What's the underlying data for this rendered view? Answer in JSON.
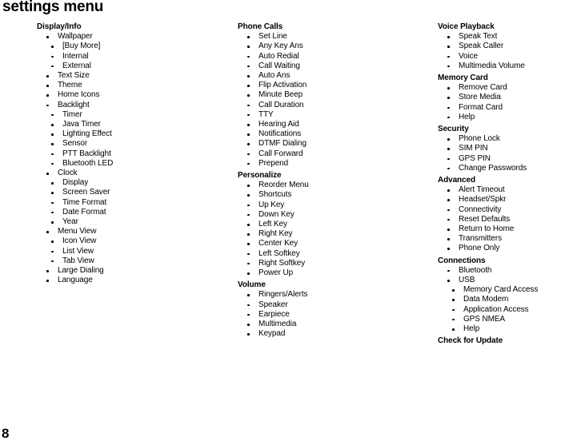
{
  "page": {
    "title": "settings menu",
    "number": "8"
  },
  "columns": [
    {
      "id": "col-1",
      "sections": [
        {
          "header": "Display/Info",
          "items": [
            {
              "label": "Wallpaper",
              "children": [
                {
                  "label": "[Buy More]"
                },
                {
                  "label": "Internal"
                },
                {
                  "label": "External"
                }
              ]
            },
            {
              "label": "Text Size"
            },
            {
              "label": "Theme"
            },
            {
              "label": "Home Icons"
            },
            {
              "label": "Backlight",
              "children": [
                {
                  "label": "Timer"
                },
                {
                  "label": "Java Timer"
                },
                {
                  "label": "Lighting Effect"
                },
                {
                  "label": "Sensor"
                },
                {
                  "label": "PTT Backlight"
                },
                {
                  "label": "Bluetooth LED"
                }
              ]
            },
            {
              "label": "Clock",
              "children": [
                {
                  "label": "Display"
                },
                {
                  "label": "Screen Saver"
                },
                {
                  "label": "Time Format"
                },
                {
                  "label": "Date Format"
                },
                {
                  "label": "Year"
                }
              ]
            },
            {
              "label": "Menu View",
              "children": [
                {
                  "label": "Icon View"
                },
                {
                  "label": "List View"
                },
                {
                  "label": "Tab View"
                }
              ]
            },
            {
              "label": "Large Dialing"
            },
            {
              "label": "Language"
            }
          ]
        }
      ]
    },
    {
      "id": "col-2",
      "sections": [
        {
          "header": "Phone Calls",
          "items": [
            {
              "label": "Set Line"
            },
            {
              "label": "Any Key Ans"
            },
            {
              "label": "Auto Redial"
            },
            {
              "label": "Call Waiting"
            },
            {
              "label": "Auto Ans"
            },
            {
              "label": "Flip Activation"
            },
            {
              "label": "Minute Beep"
            },
            {
              "label": "Call Duration"
            },
            {
              "label": "TTY"
            },
            {
              "label": "Hearing Aid"
            },
            {
              "label": "Notifications"
            },
            {
              "label": "DTMF Dialing"
            },
            {
              "label": "Call Forward"
            },
            {
              "label": "Prepend"
            }
          ]
        },
        {
          "header": "Personalize",
          "items": [
            {
              "label": "Reorder Menu"
            },
            {
              "label": "Shortcuts"
            },
            {
              "label": "Up Key"
            },
            {
              "label": "Down Key"
            },
            {
              "label": "Left Key"
            },
            {
              "label": "Right Key"
            },
            {
              "label": "Center Key"
            },
            {
              "label": "Left Softkey"
            },
            {
              "label": "Right Softkey"
            },
            {
              "label": "Power Up"
            }
          ]
        },
        {
          "header": "Volume",
          "items": [
            {
              "label": "Ringers/Alerts"
            },
            {
              "label": "Speaker"
            },
            {
              "label": "Earpiece"
            },
            {
              "label": "Multimedia"
            },
            {
              "label": "Keypad"
            }
          ]
        }
      ]
    },
    {
      "id": "col-3",
      "sections": [
        {
          "header": "Voice Playback",
          "items": [
            {
              "label": "Speak Text"
            },
            {
              "label": "Speak Caller"
            },
            {
              "label": "Voice"
            },
            {
              "label": "Multimedia Volume"
            }
          ]
        },
        {
          "header": "Memory Card",
          "items": [
            {
              "label": "Remove Card"
            },
            {
              "label": "Store Media"
            },
            {
              "label": "Format Card"
            },
            {
              "label": "Help"
            }
          ]
        },
        {
          "header": "Security",
          "items": [
            {
              "label": "Phone Lock"
            },
            {
              "label": "SIM PIN"
            },
            {
              "label": "GPS PIN"
            },
            {
              "label": "Change Passwords"
            }
          ]
        },
        {
          "header": "Advanced",
          "items": [
            {
              "label": "Alert Timeout"
            },
            {
              "label": "Headset/Spkr"
            },
            {
              "label": "Connectivity"
            },
            {
              "label": "Reset Defaults"
            },
            {
              "label": "Return to Home"
            },
            {
              "label": "Transmitters"
            },
            {
              "label": "Phone Only"
            }
          ]
        },
        {
          "header": "Connections",
          "items": [
            {
              "label": "Bluetooth"
            },
            {
              "label": "USB",
              "children": [
                {
                  "label": "Memory Card Access"
                },
                {
                  "label": "Data Modem"
                },
                {
                  "label": "Application Access"
                },
                {
                  "label": "GPS NMEA"
                },
                {
                  "label": "Help"
                }
              ]
            }
          ]
        },
        {
          "header": "Check for Update",
          "items": []
        }
      ]
    }
  ]
}
